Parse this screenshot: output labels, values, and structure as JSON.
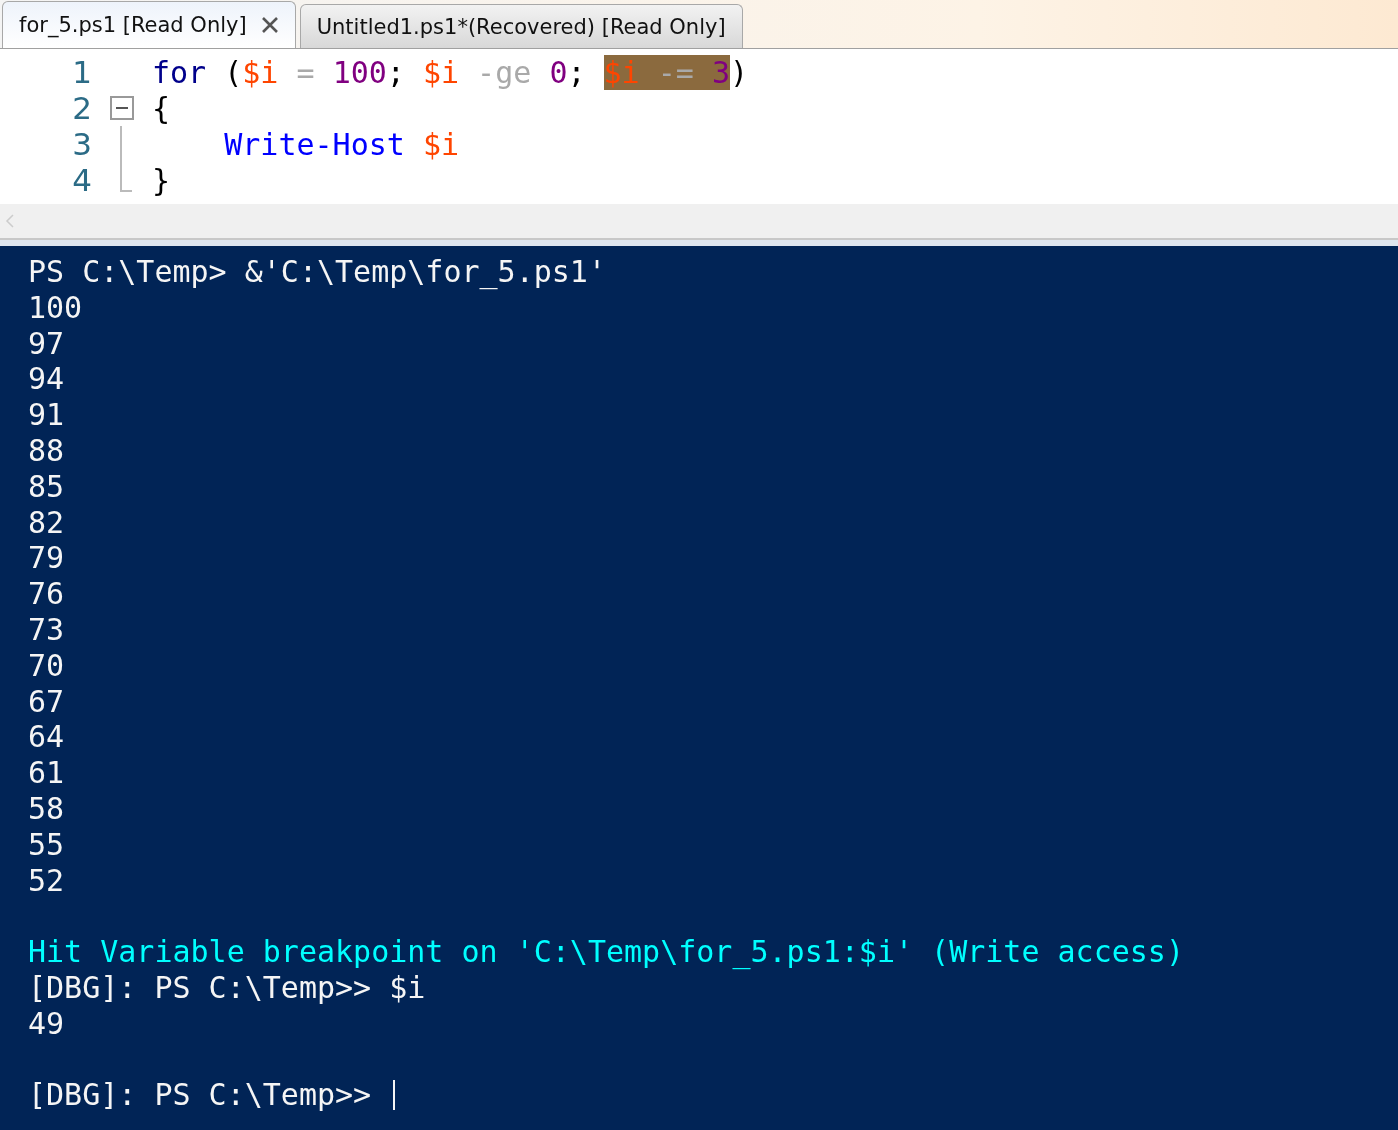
{
  "tabs": [
    {
      "label": "for_5.ps1 [Read Only]",
      "selected": true,
      "closable": true
    },
    {
      "label": "Untitled1.ps1*(Recovered) [Read Only]",
      "selected": false,
      "closable": false
    }
  ],
  "editor": {
    "lines": [
      {
        "number": "1",
        "kind": "plain",
        "tokens": [
          {
            "kind": "keyword",
            "text": "for"
          },
          {
            "kind": "plain",
            "text": " ("
          },
          {
            "kind": "variable",
            "text": "$i"
          },
          {
            "kind": "operator",
            "text": " = "
          },
          {
            "kind": "number",
            "text": "100"
          },
          {
            "kind": "plain",
            "text": "; "
          },
          {
            "kind": "variable",
            "text": "$i"
          },
          {
            "kind": "operator",
            "text": " -ge "
          },
          {
            "kind": "number",
            "text": "0"
          },
          {
            "kind": "plain",
            "text": "; "
          },
          {
            "kind": "highlight",
            "tokens": [
              {
                "kind": "variable",
                "text": "$i"
              },
              {
                "kind": "operator",
                "text": " -= "
              },
              {
                "kind": "number",
                "text": "3"
              }
            ]
          },
          {
            "kind": "plain",
            "text": ")"
          }
        ]
      },
      {
        "number": "2",
        "kind": "fold-start",
        "tokens": [
          {
            "kind": "plain",
            "text": "{"
          }
        ]
      },
      {
        "number": "3",
        "kind": "fold-inside",
        "tokens": [
          {
            "kind": "cmdlet",
            "text": "    Write-Host "
          },
          {
            "kind": "variable",
            "text": "$i"
          }
        ]
      },
      {
        "number": "4",
        "kind": "fold-end",
        "tokens": [
          {
            "kind": "plain",
            "text": "}"
          }
        ]
      }
    ]
  },
  "console": {
    "lines": [
      {
        "kind": "output",
        "text": "PS C:\\Temp> &'C:\\Temp\\for_5.ps1'"
      },
      {
        "kind": "output",
        "text": "100"
      },
      {
        "kind": "output",
        "text": "97"
      },
      {
        "kind": "output",
        "text": "94"
      },
      {
        "kind": "output",
        "text": "91"
      },
      {
        "kind": "output",
        "text": "88"
      },
      {
        "kind": "output",
        "text": "85"
      },
      {
        "kind": "output",
        "text": "82"
      },
      {
        "kind": "output",
        "text": "79"
      },
      {
        "kind": "output",
        "text": "76"
      },
      {
        "kind": "output",
        "text": "73"
      },
      {
        "kind": "output",
        "text": "70"
      },
      {
        "kind": "output",
        "text": "67"
      },
      {
        "kind": "output",
        "text": "64"
      },
      {
        "kind": "output",
        "text": "61"
      },
      {
        "kind": "output",
        "text": "58"
      },
      {
        "kind": "output",
        "text": "55"
      },
      {
        "kind": "output",
        "text": "52"
      },
      {
        "kind": "blank"
      },
      {
        "kind": "debug",
        "text": "Hit Variable breakpoint on 'C:\\Temp\\for_5.ps1:$i' (Write access)"
      },
      {
        "kind": "output",
        "text": "[DBG]: PS C:\\Temp>> $i"
      },
      {
        "kind": "output",
        "text": "49"
      },
      {
        "kind": "blank"
      },
      {
        "kind": "prompt",
        "text": "[DBG]: PS C:\\Temp>> "
      }
    ]
  }
}
